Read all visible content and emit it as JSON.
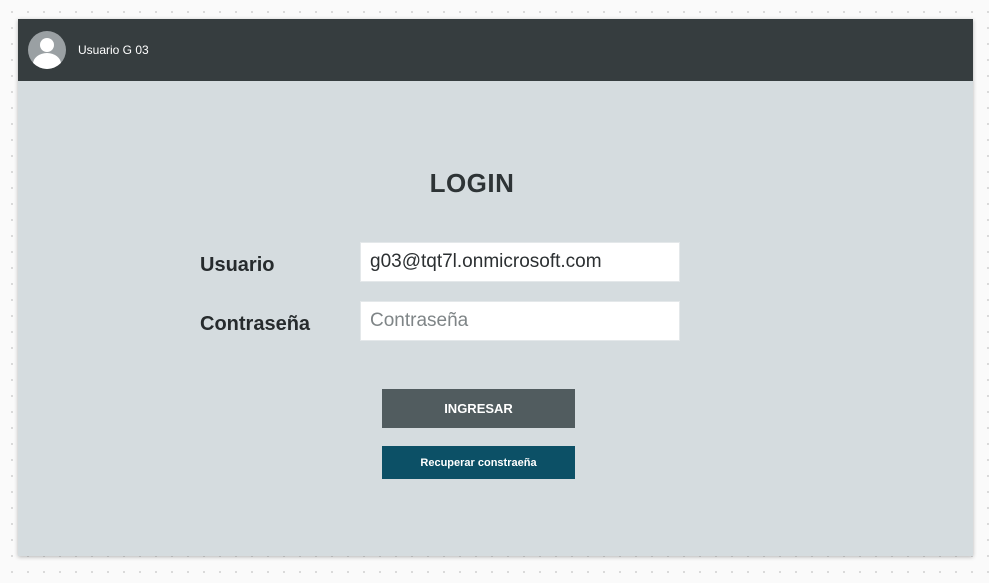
{
  "header": {
    "user_name": "Usuario G 03",
    "avatar_icon": "user-avatar-icon"
  },
  "login": {
    "title": "LOGIN",
    "user_label": "Usuario",
    "user_value": "g03@tqt7l.onmicrosoft.com",
    "password_label": "Contraseña",
    "password_placeholder": "Contraseña",
    "password_value": "",
    "submit_label": "INGRESAR",
    "recover_label": "Recuperar constraeña"
  },
  "colors": {
    "header_background": "#363d3f",
    "page_background": "#d5dcdf",
    "primary_button": "#515c5f",
    "secondary_button": "#0c5066"
  }
}
